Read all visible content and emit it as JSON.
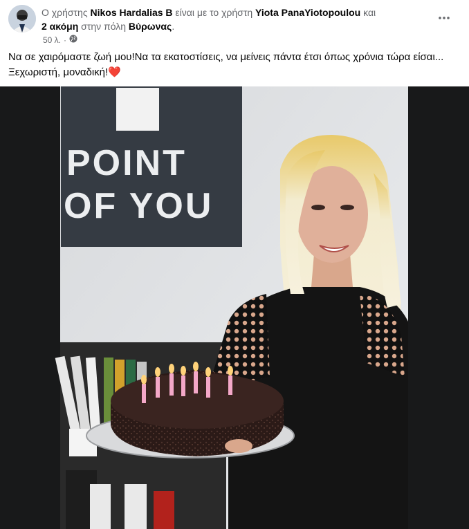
{
  "post": {
    "prefix": "Ο χρήστης ",
    "author": "Nikos Hardalias Β",
    "with_text": " είναι με το χρήστη ",
    "tagged": "Yiota PanaYiotopoulou",
    "and_text": " και",
    "others": "2 ακόμη",
    "city_text": " στην πόλη ",
    "city": "Βύρωνας",
    "period": ".",
    "time": "50 λ.",
    "dot": "·",
    "privacy_icon": "globe-icon",
    "more_icon": "more-horizontal-icon",
    "caption": "Να σε χαιρόμαστε ζωή μου!Να τα εκατοστίσεις, να μείνεις πάντα έτσι όπως χρόνια τώρα είσαι... Ξεχωριστή, μοναδική!",
    "heart": "❤️"
  },
  "photo": {
    "sign_line1": "POINT",
    "sign_line2": "OF YOU"
  }
}
